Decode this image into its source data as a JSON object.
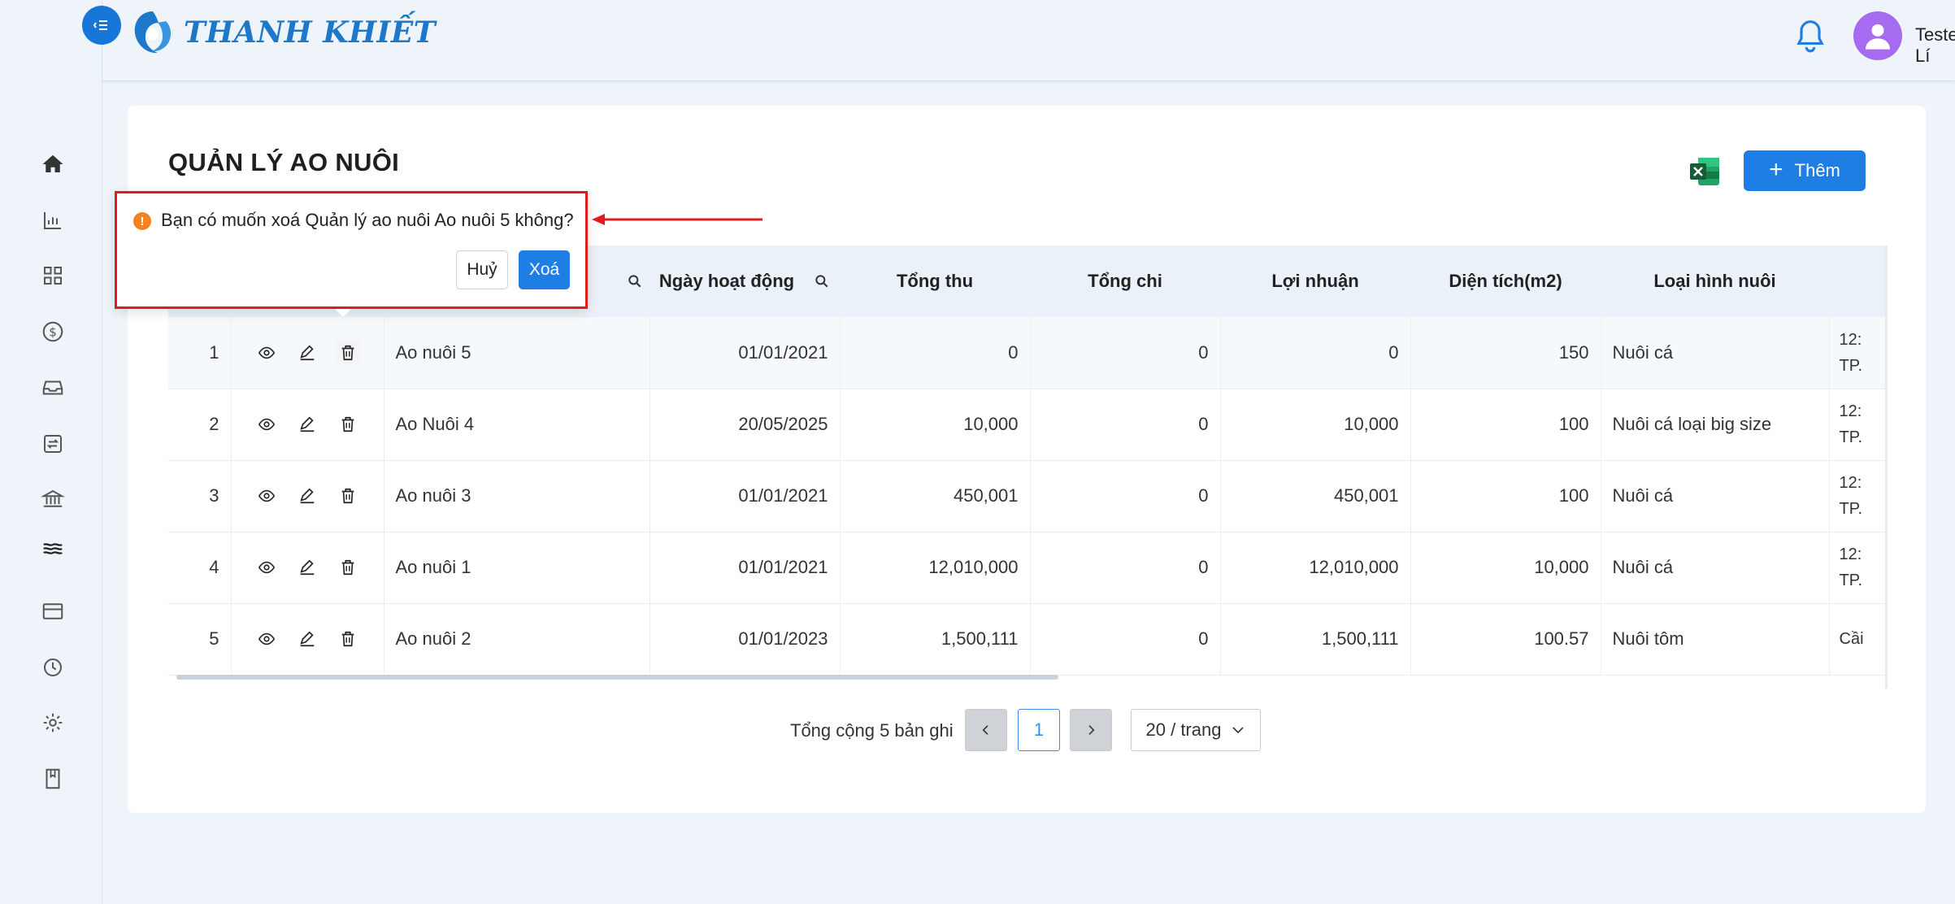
{
  "app": {
    "brand": "THANH KHIẾT"
  },
  "header": {
    "username": "Tester Lí"
  },
  "page": {
    "title": "QUẢN LÝ AO NUÔI",
    "add_label": "Thêm"
  },
  "table": {
    "columns": {
      "date": "Ngày hoạt động",
      "revenue": "Tổng thu",
      "expense": "Tổng chi",
      "profit": "Lợi nhuận",
      "area": "Diện tích(m2)",
      "type": "Loại hình nuôi"
    },
    "rows": [
      {
        "stt": "1",
        "name": "Ao nuôi 5",
        "date": "01/01/2021",
        "revenue": "0",
        "expense": "0",
        "profit": "0",
        "area": "150",
        "type": "Nuôi cá",
        "addr1": "12:",
        "addr2": "TP."
      },
      {
        "stt": "2",
        "name": "Ao Nuôi 4",
        "date": "20/05/2025",
        "revenue": "10,000",
        "expense": "0",
        "profit": "10,000",
        "area": "100",
        "type": "Nuôi cá loại big size",
        "addr1": "12:",
        "addr2": "TP."
      },
      {
        "stt": "3",
        "name": "Ao nuôi 3",
        "date": "01/01/2021",
        "revenue": "450,001",
        "expense": "0",
        "profit": "450,001",
        "area": "100",
        "type": "Nuôi cá",
        "addr1": "12:",
        "addr2": "TP."
      },
      {
        "stt": "4",
        "name": "Ao nuôi 1",
        "date": "01/01/2021",
        "revenue": "12,010,000",
        "expense": "0",
        "profit": "12,010,000",
        "area": "10,000",
        "type": "Nuôi cá",
        "addr1": "12:",
        "addr2": "TP."
      },
      {
        "stt": "5",
        "name": "Ao nuôi 2",
        "date": "01/01/2023",
        "revenue": "1,500,111",
        "expense": "0",
        "profit": "1,500,111",
        "area": "100.57",
        "type": "Nuôi tôm",
        "addr1": "Cầi",
        "addr2": ""
      }
    ]
  },
  "pagination": {
    "total": "Tổng cộng 5 bản ghi",
    "current": "1",
    "page_size": "20 / trang"
  },
  "popconfirm": {
    "message": "Bạn có muốn xoá Quản lý ao nuôi Ao nuôi 5 không?",
    "cancel": "Huỷ",
    "ok": "Xoá"
  },
  "colors": {
    "primary": "#1f7ee4",
    "highlight": "#e01d1d",
    "warning": "#f5821f",
    "avatar": "#a66bf0"
  }
}
